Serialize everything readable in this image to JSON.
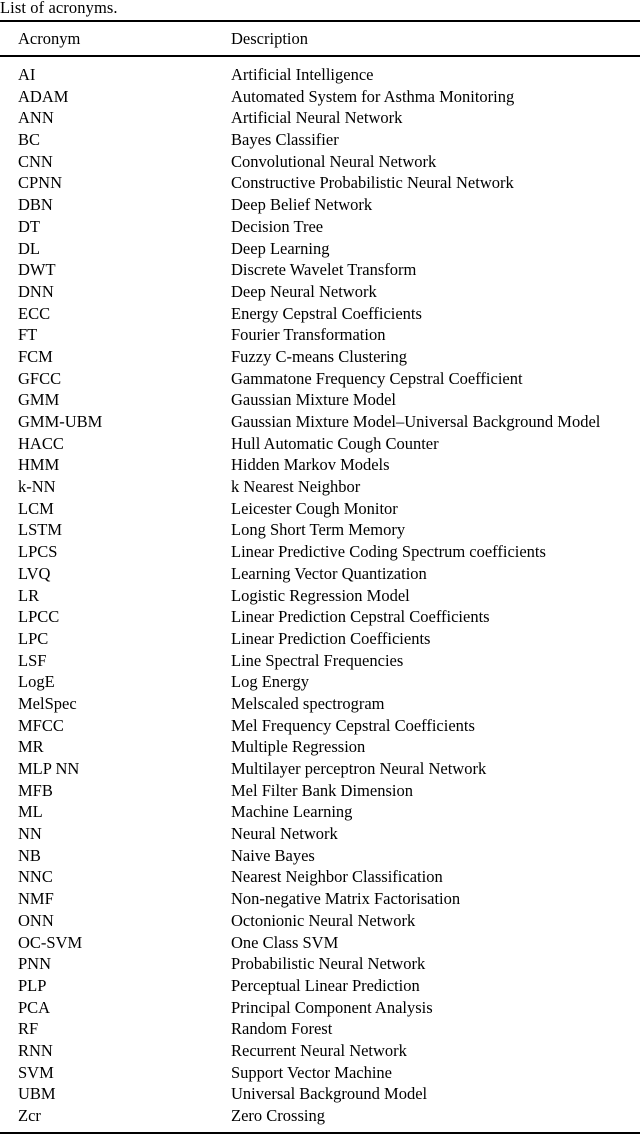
{
  "caption": "List of acronyms.",
  "table": {
    "columns": [
      {
        "key": "acronym",
        "header": "Acronym"
      },
      {
        "key": "description",
        "header": "Description"
      }
    ],
    "rows": [
      {
        "acronym": "AI",
        "description": "Artificial Intelligence"
      },
      {
        "acronym": "ADAM",
        "description": "Automated System for Asthma Monitoring"
      },
      {
        "acronym": "ANN",
        "description": "Artificial Neural Network"
      },
      {
        "acronym": "BC",
        "description": "Bayes Classifier"
      },
      {
        "acronym": "CNN",
        "description": "Convolutional Neural Network"
      },
      {
        "acronym": "CPNN",
        "description": "Constructive Probabilistic Neural Network"
      },
      {
        "acronym": "DBN",
        "description": "Deep Belief Network"
      },
      {
        "acronym": "DT",
        "description": "Decision Tree"
      },
      {
        "acronym": "DL",
        "description": "Deep Learning"
      },
      {
        "acronym": "DWT",
        "description": "Discrete Wavelet Transform"
      },
      {
        "acronym": "DNN",
        "description": "Deep Neural Network"
      },
      {
        "acronym": "ECC",
        "description": "Energy Cepstral Coefficients"
      },
      {
        "acronym": "FT",
        "description": "Fourier Transformation"
      },
      {
        "acronym": "FCM",
        "description": "Fuzzy C-means Clustering"
      },
      {
        "acronym": "GFCC",
        "description": "Gammatone Frequency Cepstral Coefficient"
      },
      {
        "acronym": "GMM",
        "description": "Gaussian Mixture Model"
      },
      {
        "acronym": "GMM-UBM",
        "description": "Gaussian Mixture Model–Universal Background Model"
      },
      {
        "acronym": "HACC",
        "description": "Hull Automatic Cough Counter"
      },
      {
        "acronym": "HMM",
        "description": "Hidden Markov Models"
      },
      {
        "acronym": "k-NN",
        "description": "k Nearest Neighbor"
      },
      {
        "acronym": "LCM",
        "description": "Leicester Cough Monitor"
      },
      {
        "acronym": "LSTM",
        "description": "Long Short Term Memory"
      },
      {
        "acronym": "LPCS",
        "description": "Linear Predictive Coding Spectrum coefficients"
      },
      {
        "acronym": "LVQ",
        "description": "Learning Vector Quantization"
      },
      {
        "acronym": "LR",
        "description": "Logistic Regression Model"
      },
      {
        "acronym": "LPCC",
        "description": "Linear Prediction Cepstral Coefficients"
      },
      {
        "acronym": "LPC",
        "description": "Linear Prediction Coefficients"
      },
      {
        "acronym": "LSF",
        "description": "Line Spectral Frequencies"
      },
      {
        "acronym": "LogE",
        "description": "Log Energy"
      },
      {
        "acronym": "MelSpec",
        "description": "Melscaled spectrogram"
      },
      {
        "acronym": "MFCC",
        "description": "Mel Frequency Cepstral Coefficients"
      },
      {
        "acronym": "MR",
        "description": "Multiple Regression"
      },
      {
        "acronym": "MLP NN",
        "description": "Multilayer perceptron Neural Network"
      },
      {
        "acronym": "MFB",
        "description": "Mel Filter Bank Dimension"
      },
      {
        "acronym": "ML",
        "description": "Machine Learning"
      },
      {
        "acronym": "NN",
        "description": "Neural Network"
      },
      {
        "acronym": "NB",
        "description": "Naive Bayes"
      },
      {
        "acronym": "NNC",
        "description": "Nearest Neighbor Classification"
      },
      {
        "acronym": "NMF",
        "description": "Non-negative Matrix Factorisation"
      },
      {
        "acronym": "ONN",
        "description": "Octonionic Neural Network"
      },
      {
        "acronym": "OC-SVM",
        "description": "One Class SVM"
      },
      {
        "acronym": "PNN",
        "description": "Probabilistic Neural Network"
      },
      {
        "acronym": "PLP",
        "description": "Perceptual Linear Prediction"
      },
      {
        "acronym": "PCA",
        "description": "Principal Component Analysis"
      },
      {
        "acronym": "RF",
        "description": "Random Forest"
      },
      {
        "acronym": "RNN",
        "description": "Recurrent Neural Network"
      },
      {
        "acronym": "SVM",
        "description": "Support Vector Machine"
      },
      {
        "acronym": "UBM",
        "description": "Universal Background Model"
      },
      {
        "acronym": "Zcr",
        "description": "Zero Crossing"
      }
    ]
  },
  "colors": {
    "text": "#000000",
    "rule": "#000000",
    "background": "#ffffff"
  }
}
